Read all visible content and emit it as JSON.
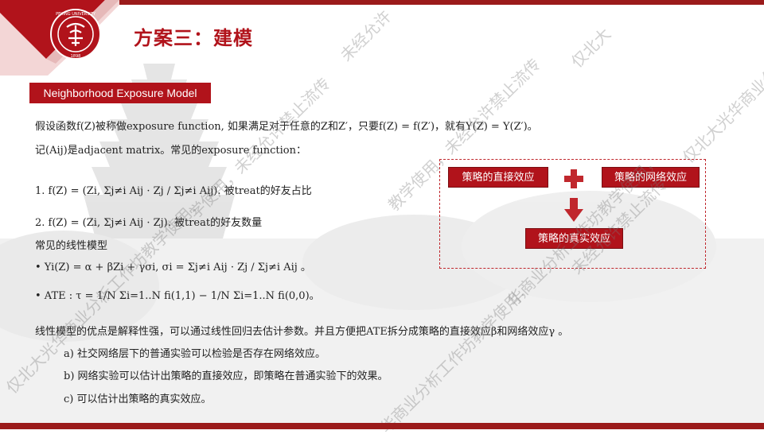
{
  "header": {
    "title": "方案三：建模",
    "logo_alt_text": "PEKING UNIVERSITY 1898"
  },
  "tag_label": "Neighborhood Exposure Model",
  "body": {
    "line1": "假设函数f(Z)被称做exposure function, 如果满足对于任意的Z和Z′，只要f(Z) = f(Z′)，就有Y(Z) = Y(Z′)。",
    "line2": "记(Aij)是adjacent matrix。常见的exposure function：",
    "item1": "1.  f(Z) = (Zi, Σj≠i Aij · Zj / Σj≠i Aij). 被treat的好友占比",
    "item2": "2.  f(Z) = (Zi, Σj≠i Aij · Zj). 被treat的好友数量",
    "linear_model_heading": "常见的线性模型",
    "bullet1": "• Yi(Z) = α + βZi + γσi,    σi = Σj≠i Aij · Zj / Σj≠i Aij 。",
    "bullet2": "• ATE : τ = 1/N Σi=1..N fi(1,1) − 1/N Σi=1..N fi(0,0)。",
    "summary": "线性模型的优点是解释性强，可以通过线性回归去估计参数。并且方便把ATE拆分成策略的直接效应β和网络效应γ 。",
    "point_a": "a) 社交网络层下的普通实验可以检验是否存在网络效应。",
    "point_b": "b) 网络实验可以估计出策略的直接效应，即策略在普通实验下的效果。",
    "point_c": "c) 可以估计出策略的真实效应。"
  },
  "diagram": {
    "direct_effect": "策略的直接效应",
    "network_effect": "策略的网络效应",
    "true_effect": "策略的真实效应",
    "plus_icon": "plus-icon",
    "arrow_icon": "arrow-down-icon"
  },
  "watermarks": [
    "未经允许",
    "仅北大",
    "仅北大光华商业分",
    "学使用，未经允许禁止流传",
    "华商业分析工作坊教学使用，",
    "教学使用，未经允许禁止流传",
    "未经允许禁止流传",
    "仅北大光华商业分析工作坊教学使用，",
    "华商业分析工作坊教学使用，"
  ],
  "colors": {
    "brand_red": "#b1131b",
    "bar_red": "#9b1b1b"
  }
}
